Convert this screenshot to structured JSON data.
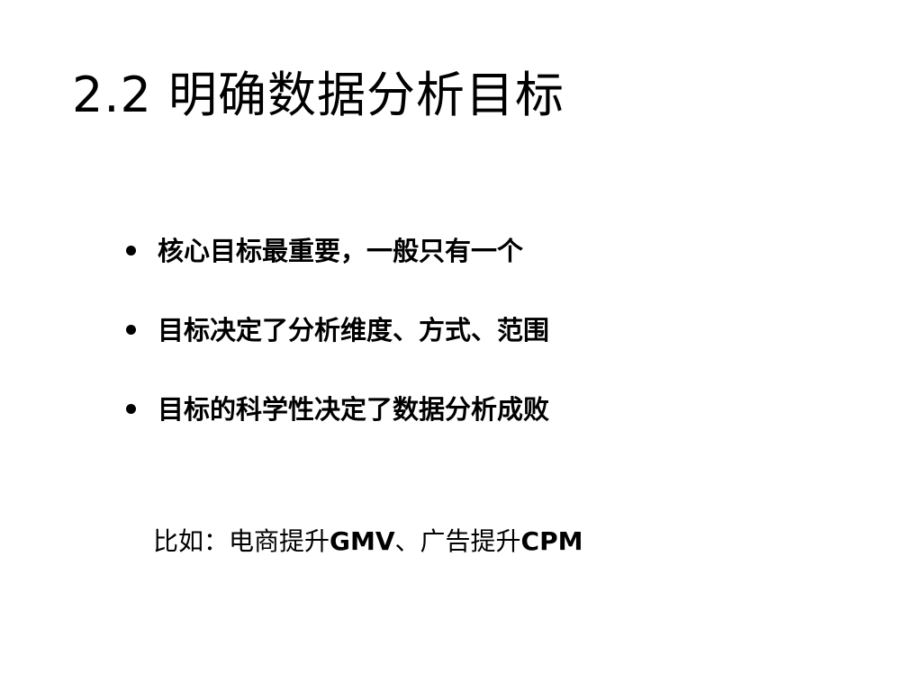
{
  "slide": {
    "title": "2.2 明确数据分析目标",
    "bullets": [
      {
        "text": "核心目标最重要，一般只有一个"
      },
      {
        "text": "目标决定了分析维度、方式、范围"
      },
      {
        "text": "目标的科学性决定了数据分析成败"
      }
    ],
    "example": {
      "prefix": "比如：电商提升",
      "metric_1": "GMV",
      "separator": "、广告提升",
      "metric_2": "CPM"
    }
  }
}
